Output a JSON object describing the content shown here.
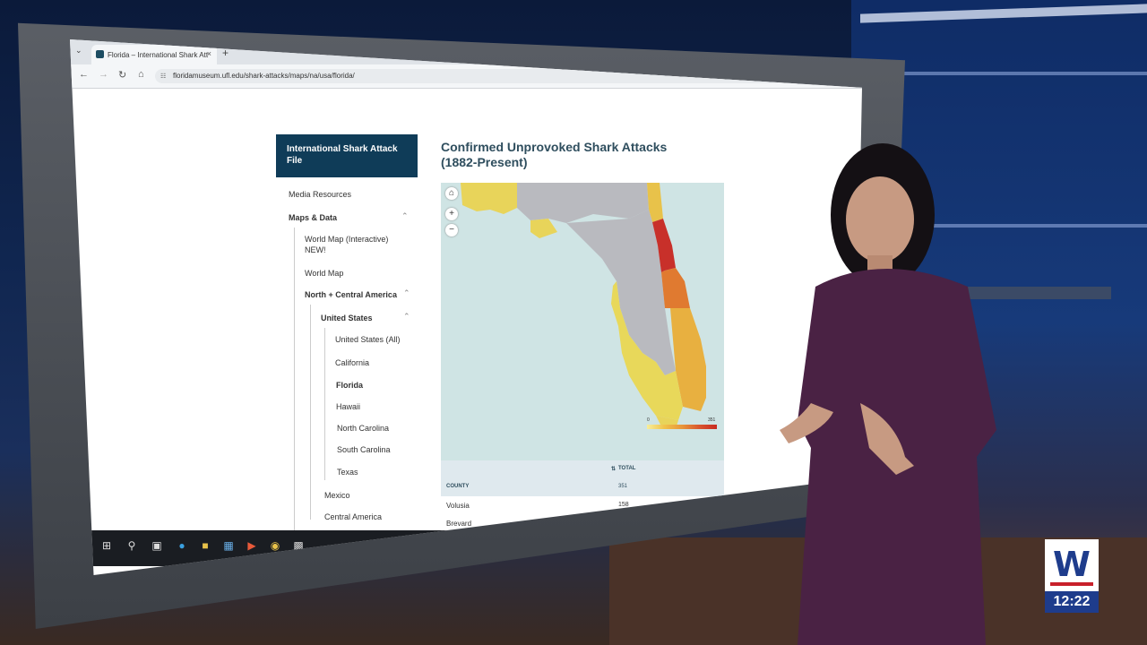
{
  "browser": {
    "tab_title": "Florida – International Shark Att",
    "tab_close": "×",
    "new_tab": "+",
    "url": "floridamuseum.ufl.edu/shark-attacks/maps/na/usa/florida/"
  },
  "sidebar": {
    "header": "International Shark Attack File",
    "items": [
      {
        "label": "Media Resources"
      },
      {
        "label": "Maps & Data"
      },
      {
        "label": "World Map (Interactive)"
      },
      {
        "label": "NEW!"
      },
      {
        "label": "World Map"
      },
      {
        "label": "North + Central America"
      },
      {
        "label": "United States"
      },
      {
        "label": "United States (All)"
      },
      {
        "label": "California"
      },
      {
        "label": "Florida"
      },
      {
        "label": "Hawaii"
      },
      {
        "label": "North Carolina"
      },
      {
        "label": "South Carolina"
      },
      {
        "label": "Texas"
      },
      {
        "label": "Mexico"
      },
      {
        "label": "Central America"
      }
    ]
  },
  "main": {
    "title": "Confirmed Unprovoked Shark Attacks (1882-Present)",
    "map": {
      "legend_min": "0",
      "legend_max": "351"
    },
    "table": {
      "col_total": "TOTAL",
      "col_county": "COUNTY",
      "total_value": "351",
      "rows": [
        {
          "county": "Volusia",
          "value": "158"
        },
        {
          "county": "Brevard",
          "value": ""
        }
      ]
    }
  },
  "broadcast": {
    "logo_letter": "W",
    "time": "12:22"
  },
  "colors": {
    "sidebar_header": "#0f3c58",
    "title": "#2f4e5e",
    "brand_blue": "#1e3c8c",
    "brand_red": "#c8202a"
  }
}
